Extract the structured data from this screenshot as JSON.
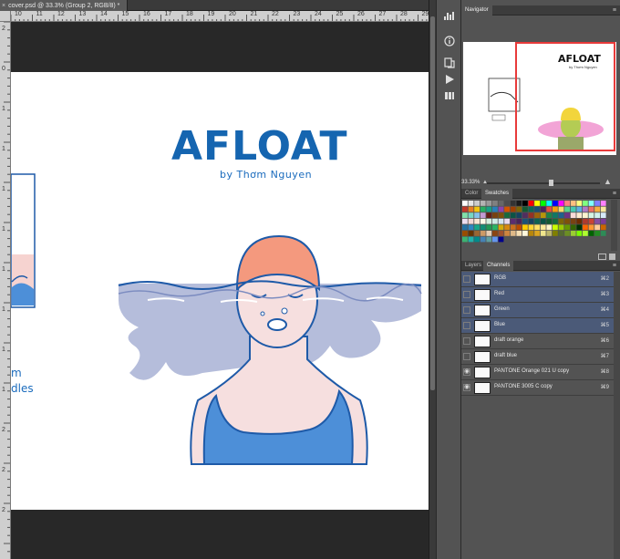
{
  "document": {
    "tab_title": "cover.psd @ 33.3% (Group 2, RGB/8) *",
    "close_symbol": "×"
  },
  "rulers": {
    "top": [
      "10",
      "11",
      "12",
      "13",
      "14",
      "15",
      "16",
      "17",
      "18",
      "19",
      "20",
      "21",
      "22",
      "23",
      "24",
      "25",
      "26",
      "27",
      "28",
      "29"
    ],
    "left": [
      "2",
      "0",
      "1",
      "1",
      "1",
      "1",
      "1",
      "1",
      "1",
      "1",
      "2",
      "2",
      "2"
    ]
  },
  "canvas": {
    "title": "AFLOAT",
    "byline": "by Thơm Nguyen",
    "left_fragment_1": "m",
    "left_fragment_2": "dles",
    "colors": {
      "title": "#1565b0",
      "cap": "#f4997e",
      "water": "#b5bddb",
      "skin": "#f6dfdf",
      "suit": "#4d8fd8",
      "outline": "#1e5aa8"
    }
  },
  "navigator": {
    "tab": "Navigator",
    "zoom": "33.33%",
    "preview_title": "AFLOAT",
    "preview_byline": "by Thơm Nguyen"
  },
  "swatches": {
    "tab_color": "Color",
    "tab_swatches": "Swatches",
    "colors": [
      "#ffffff",
      "#e6e6e6",
      "#cccccc",
      "#b3b3b3",
      "#999999",
      "#808080",
      "#666666",
      "#4d4d4d",
      "#333333",
      "#1a1a1a",
      "#000000",
      "#ff0000",
      "#ffff00",
      "#00ff00",
      "#00ffff",
      "#0000ff",
      "#ff00ff",
      "#ff8080",
      "#ffbf80",
      "#ffff80",
      "#80ff80",
      "#80ffff",
      "#8080ff",
      "#ff80ff",
      "#c0392b",
      "#e67e22",
      "#f1c40f",
      "#27ae60",
      "#16a085",
      "#2980b9",
      "#8e44ad",
      "#d35400",
      "#a04000",
      "#7d6608",
      "#145a32",
      "#0e6655",
      "#1b4f72",
      "#4a235a",
      "#e74c3c",
      "#f39c12",
      "#f7dc6f",
      "#58d68d",
      "#48c9b0",
      "#5dade2",
      "#af7ac5",
      "#ec7063",
      "#f5b041",
      "#f9e79f",
      "#82e0aa",
      "#76d7c4",
      "#85c1e9",
      "#c39bd3",
      "#641e16",
      "#784212",
      "#7e5109",
      "#186a3b",
      "#0b5345",
      "#154360",
      "#512e5f",
      "#943126",
      "#9c640c",
      "#b7950b",
      "#1d8348",
      "#117864",
      "#1f618d",
      "#6c3483",
      "#fadbd8",
      "#fdebd0",
      "#fcf3cf",
      "#d5f5e3",
      "#d1f2eb",
      "#d6eaf8",
      "#ebdef0",
      "#f2d7d5",
      "#fae5d3",
      "#fef9e7",
      "#d4efdf",
      "#d0ece7",
      "#d4e6f1",
      "#e8daef",
      "#5b2c6f",
      "#4a235a",
      "#1a5276",
      "#154360",
      "#0e6251",
      "#0b5345",
      "#145a32",
      "#186a3b",
      "#7d6608",
      "#7e5109",
      "#784212",
      "#6e2c00",
      "#b03a2e",
      "#cb4335",
      "#884ea0",
      "#7d3c98",
      "#2471a3",
      "#2e86c1",
      "#17a589",
      "#138d75",
      "#229954",
      "#28b463",
      "#d4ac0d",
      "#d68910",
      "#ca6f1e",
      "#ba4a00",
      "#ffcc00",
      "#ffd633",
      "#ffe066",
      "#ffeb99",
      "#fff5cc",
      "#ccff00",
      "#99cc00",
      "#669900",
      "#336600",
      "#003300",
      "#ff6600",
      "#ff9933",
      "#ffcc99",
      "#cc6600",
      "#994c00",
      "#663300",
      "#996633",
      "#cc9966",
      "#e6ccb3",
      "#8b4513",
      "#a0522d",
      "#cd853f",
      "#deb887",
      "#f5deb3",
      "#fff8dc",
      "#b8860b",
      "#daa520",
      "#f0e68c",
      "#bdb76b",
      "#808000",
      "#556b2f",
      "#6b8e23",
      "#9acd32",
      "#7cfc00",
      "#adff2f",
      "#006400",
      "#228b22",
      "#2e8b57",
      "#3cb371",
      "#20b2aa",
      "#008b8b",
      "#4682b4",
      "#5f9ea0",
      "#6495ed",
      "#00008b"
    ]
  },
  "channels": {
    "tab_layers": "Layers",
    "tab_channels": "Channels",
    "rows": [
      {
        "name": "RGB",
        "key": "⌘2",
        "selected": true,
        "eye": ""
      },
      {
        "name": "Red",
        "key": "⌘3",
        "selected": true,
        "eye": ""
      },
      {
        "name": "Green",
        "key": "⌘4",
        "selected": true,
        "eye": ""
      },
      {
        "name": "Blue",
        "key": "⌘5",
        "selected": true,
        "eye": ""
      },
      {
        "name": "draft orange",
        "key": "⌘6",
        "selected": false,
        "eye": ""
      },
      {
        "name": "draft blue",
        "key": "⌘7",
        "selected": false,
        "eye": ""
      },
      {
        "name": "PANTONE Orange 021 U copy",
        "key": "⌘8",
        "selected": false,
        "eye": "◉"
      },
      {
        "name": "PANTONE 3005 C copy",
        "key": "⌘9",
        "selected": false,
        "eye": "◉"
      }
    ]
  },
  "tool_strip": {
    "icons": [
      "histogram-icon",
      "info-icon",
      "history-icon",
      "actions-icon",
      "brush-presets-icon"
    ]
  }
}
